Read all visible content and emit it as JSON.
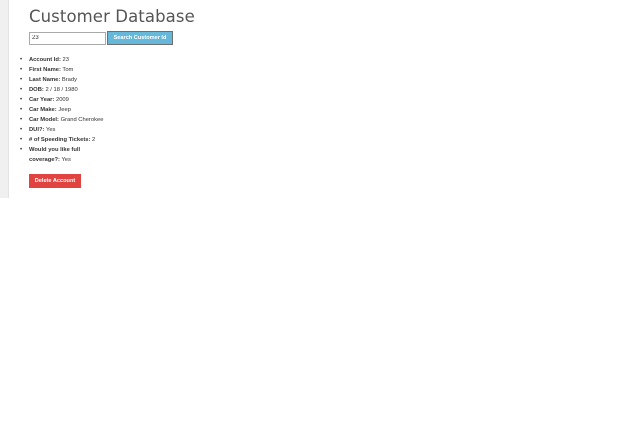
{
  "header": {
    "title": "Customer Database"
  },
  "search": {
    "value": "23",
    "button_label": "Search Customer Id"
  },
  "account": {
    "fields": [
      {
        "label": "Account Id:",
        "value": "23"
      },
      {
        "label": "First Name:",
        "value": "Tom"
      },
      {
        "label": "Last Name:",
        "value": "Brady"
      },
      {
        "label": "DOB:",
        "value": "2 / 18 / 1980"
      },
      {
        "label": "Car Year:",
        "value": "2009"
      },
      {
        "label": "Car Make:",
        "value": "Jeep"
      },
      {
        "label": "Car Model:",
        "value": "Grand Cherokee"
      },
      {
        "label": "DUI?:",
        "value": "Yes"
      },
      {
        "label": "# of Speeding Tickets:",
        "value": "2"
      },
      {
        "label": "Would you like full coverage?:",
        "value": "Yes"
      }
    ]
  },
  "actions": {
    "delete_label": "Delete Account"
  },
  "colors": {
    "search_button": "#66b8da",
    "delete_button": "#e14340",
    "title_text": "#555555"
  }
}
